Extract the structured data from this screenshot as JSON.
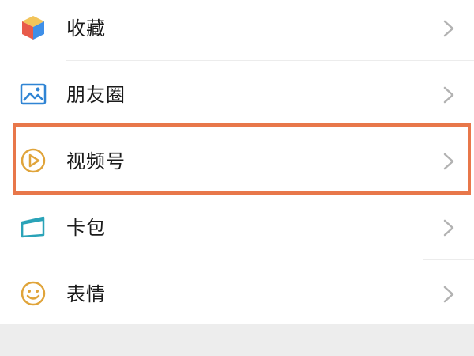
{
  "menu": {
    "items": [
      {
        "label": "收藏",
        "icon": "favorites-cube-icon"
      },
      {
        "label": "朋友圈",
        "icon": "moments-image-icon"
      },
      {
        "label": "视频号",
        "icon": "channels-play-icon"
      },
      {
        "label": "卡包",
        "icon": "card-wallet-icon"
      },
      {
        "label": "表情",
        "icon": "sticker-smiley-icon"
      }
    ]
  },
  "colors": {
    "highlight": "#e8774a",
    "text": "#1a1a1a",
    "chevron": "#b2b2b2",
    "divider": "#ececec",
    "background_gap": "#ededed"
  }
}
